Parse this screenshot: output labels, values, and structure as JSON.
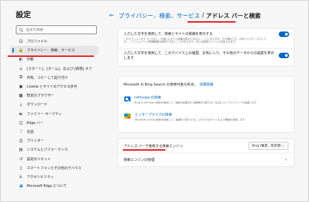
{
  "sidebar": {
    "title": "設定",
    "search_placeholder": "設定の検索",
    "items": [
      {
        "label": "プロファイル",
        "icon": "person-icon"
      },
      {
        "label": "プライバシー、検索、サービス",
        "icon": "lock-icon",
        "active": true
      },
      {
        "label": "外観",
        "icon": "palette-icon"
      },
      {
        "label": "[スタート]、[ホーム]、および [新規] タブ",
        "icon": "home-icon"
      },
      {
        "label": "共有、コピーして貼り付け",
        "icon": "share-icon"
      },
      {
        "label": "Cookie とサイトのアクセス許可",
        "icon": "cookie-icon"
      },
      {
        "label": "既定のブラウザー",
        "icon": "browser-icon"
      },
      {
        "label": "ダウンロード",
        "icon": "download-icon"
      },
      {
        "label": "ファミリー セーフティ",
        "icon": "family-icon"
      },
      {
        "label": "Edge バー",
        "icon": "edge-bar-icon"
      },
      {
        "label": "言語",
        "icon": "language-icon"
      },
      {
        "label": "プリンター",
        "icon": "printer-icon"
      },
      {
        "label": "システムとパフォーマンス",
        "icon": "system-icon"
      },
      {
        "label": "設定のリセット",
        "icon": "reset-icon"
      },
      {
        "label": "スマートフォンとその他のデバイス",
        "icon": "phone-icon"
      },
      {
        "label": "アクセシビリティ",
        "icon": "accessibility-icon"
      },
      {
        "label": "Microsoft Edge について",
        "icon": "edge-icon"
      }
    ]
  },
  "breadcrumb": {
    "parent": "プライバシー、検索、サービス",
    "separator": "/",
    "current": "アドレス バーと検索"
  },
  "card1": {
    "row1_title": "入力した文字を使用して、検索とサイトの候補を表示する",
    "row1_desc": "このオプションをオフにすると、お使いになった候補は表示されない、ことになります。その場合でも、お気に入りや（入力しても）、アドレス バーの候補機能は使用できないことがあります、または検索エンジンに送信されます。",
    "row2_title": "入力した文字を使用して、このデバイス上の履歴、お気に入り、その他のデータからの提案を表示します"
  },
  "card2": {
    "head_text": "Microsoft の Bing Search の使用可能な利点。",
    "head_link": "詳細情報",
    "inprivate_title": "InPrivate の検索",
    "inprivate_desc": "Bing の InPrivate 検索を使用して、検索の結果または関連を仕事でなくなるようにプライバシーを保護します",
    "enterprise_title": "エンタープライズの検索",
    "enterprise_desc": "Microsoft の Bing 検索を使用して、組織内で見つけることができるサイトおよび情報を検索します"
  },
  "card3": {
    "search_engine_label": "アドレス バーで使用する検索エンジン",
    "search_engine_value": "Bing (推奨、既定値)",
    "manage_label": "検索エンジンの管理"
  },
  "colors": {
    "accent": "#0067c0",
    "annotation": "#e3141b"
  }
}
